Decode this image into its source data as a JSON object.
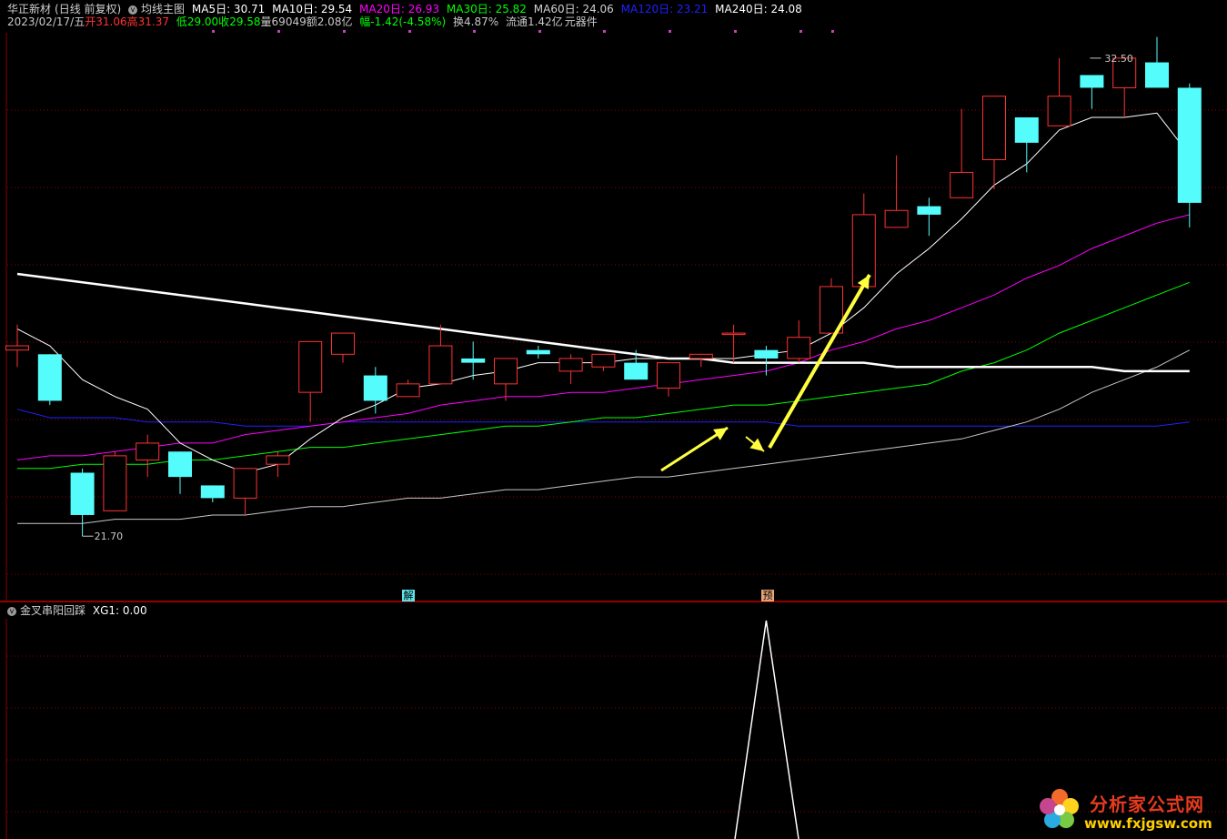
{
  "header": {
    "stock_name": "华正新材",
    "period": "(日线 前复权)",
    "indicator_name": "均线主图",
    "ma5": "MA5日: 30.71",
    "ma10": "MA10日: 29.54",
    "ma20": "MA20日: 26.93",
    "ma30": "MA30日: 25.82",
    "ma60": "MA60日: 24.06",
    "ma120": "MA120日: 23.21",
    "ma240": "MA240日: 24.08",
    "date": "2023/02/17/五",
    "open_label": "开",
    "open_val": "31.06",
    "high_label": "高",
    "high_val": "31.37",
    "low_label": "低",
    "low_val": "29.00",
    "close_label": "收",
    "close_val": "29.58",
    "volume": "量69049",
    "amount": "额2.08亿",
    "change": "幅-1.42(-4.58%)",
    "turnover": "换4.87%",
    "float_cap": "流通1.42亿",
    "sector": "元器件"
  },
  "colors": {
    "up": "#ff3232",
    "down": "#54fcfc",
    "ma5": "#ffffff",
    "ma10": "#e0e000",
    "ma20": "#ff00ff",
    "ma30": "#00ff00",
    "ma60": "#c8c8c8",
    "ma120": "#2020ff",
    "ma240": "#ffffff",
    "arrow": "#ffff40",
    "grid": "#8b0000"
  },
  "chart_data": [
    {
      "type": "candlestick",
      "ylim": [
        20.5,
        33.6
      ],
      "candles": [
        {
          "o": 26.1,
          "h": 26.7,
          "l": 25.7,
          "c": 26.2
        },
        {
          "o": 26.0,
          "h": 26.0,
          "l": 24.8,
          "c": 24.9
        },
        {
          "o": 23.2,
          "h": 23.3,
          "l": 21.7,
          "c": 22.2
        },
        {
          "o": 22.3,
          "h": 23.7,
          "l": 22.3,
          "c": 23.6
        },
        {
          "o": 23.5,
          "h": 24.1,
          "l": 23.1,
          "c": 23.9
        },
        {
          "o": 23.7,
          "h": 23.7,
          "l": 22.7,
          "c": 23.1
        },
        {
          "o": 22.9,
          "h": 22.9,
          "l": 22.5,
          "c": 22.6
        },
        {
          "o": 22.6,
          "h": 23.3,
          "l": 22.2,
          "c": 23.3
        },
        {
          "o": 23.4,
          "h": 23.7,
          "l": 23.1,
          "c": 23.6
        },
        {
          "o": 25.1,
          "h": 25.6,
          "l": 24.4,
          "c": 26.3
        },
        {
          "o": 26.0,
          "h": 26.3,
          "l": 25.8,
          "c": 26.5
        },
        {
          "o": 25.5,
          "h": 25.7,
          "l": 24.6,
          "c": 24.9
        },
        {
          "o": 25.0,
          "h": 25.4,
          "l": 25.2,
          "c": 25.3
        },
        {
          "o": 25.3,
          "h": 26.7,
          "l": 25.3,
          "c": 26.2
        },
        {
          "o": 25.9,
          "h": 26.3,
          "l": 25.4,
          "c": 25.8
        },
        {
          "o": 25.3,
          "h": 25.5,
          "l": 24.9,
          "c": 25.9
        },
        {
          "o": 26.1,
          "h": 26.2,
          "l": 25.9,
          "c": 26.0
        },
        {
          "o": 25.6,
          "h": 26.0,
          "l": 25.3,
          "c": 25.9
        },
        {
          "o": 25.7,
          "h": 25.9,
          "l": 25.6,
          "c": 26.0
        },
        {
          "o": 25.8,
          "h": 26.1,
          "l": 25.4,
          "c": 25.4
        },
        {
          "o": 25.2,
          "h": 25.7,
          "l": 25.0,
          "c": 25.8
        },
        {
          "o": 25.9,
          "h": 26.0,
          "l": 25.7,
          "c": 26.0
        },
        {
          "o": 26.5,
          "h": 26.7,
          "l": 25.8,
          "c": 26.5
        },
        {
          "o": 26.1,
          "h": 26.2,
          "l": 25.5,
          "c": 25.9
        },
        {
          "o": 25.9,
          "h": 26.8,
          "l": 25.8,
          "c": 26.4
        },
        {
          "o": 26.5,
          "h": 27.8,
          "l": 26.5,
          "c": 27.6
        },
        {
          "o": 27.6,
          "h": 29.8,
          "l": 27.6,
          "c": 29.3
        },
        {
          "o": 29.0,
          "h": 30.7,
          "l": 29.0,
          "c": 29.4
        },
        {
          "o": 29.5,
          "h": 29.7,
          "l": 28.8,
          "c": 29.3
        },
        {
          "o": 29.7,
          "h": 31.8,
          "l": 29.7,
          "c": 30.3
        },
        {
          "o": 30.6,
          "h": 32.1,
          "l": 29.9,
          "c": 32.1
        },
        {
          "o": 31.6,
          "h": 31.6,
          "l": 30.3,
          "c": 31.0
        },
        {
          "o": 31.4,
          "h": 33.0,
          "l": 31.4,
          "c": 32.1
        },
        {
          "o": 32.6,
          "h": 32.6,
          "l": 31.8,
          "c": 32.3
        },
        {
          "o": 32.3,
          "h": 32.9,
          "l": 31.6,
          "c": 33.0
        },
        {
          "o": 32.9,
          "h": 33.5,
          "l": 32.5,
          "c": 32.3
        },
        {
          "o": 32.3,
          "h": 32.4,
          "l": 29.0,
          "c": 29.58
        }
      ],
      "ma5": [
        26.6,
        26.2,
        25.4,
        25.0,
        24.7,
        23.9,
        23.5,
        23.2,
        23.4,
        24.0,
        24.5,
        24.8,
        25.2,
        25.3,
        25.5,
        25.6,
        25.8,
        25.8,
        25.8,
        25.9,
        25.9,
        25.9,
        25.9,
        26.0,
        26.1,
        26.5,
        27.1,
        27.9,
        28.5,
        29.2,
        30.0,
        30.5,
        31.3,
        31.6,
        31.6,
        31.7,
        30.71
      ],
      "ma20": [
        23.5,
        23.6,
        23.6,
        23.7,
        23.8,
        23.9,
        23.9,
        24.1,
        24.2,
        24.3,
        24.4,
        24.5,
        24.6,
        24.8,
        24.9,
        25.0,
        25.0,
        25.1,
        25.1,
        25.2,
        25.3,
        25.4,
        25.5,
        25.6,
        25.8,
        26.1,
        26.3,
        26.6,
        26.8,
        27.1,
        27.4,
        27.8,
        28.1,
        28.5,
        28.8,
        29.1,
        29.3
      ],
      "ma30": [
        23.3,
        23.3,
        23.4,
        23.4,
        23.4,
        23.5,
        23.5,
        23.6,
        23.7,
        23.8,
        23.8,
        23.9,
        24.0,
        24.1,
        24.2,
        24.3,
        24.3,
        24.4,
        24.5,
        24.5,
        24.6,
        24.7,
        24.8,
        24.8,
        24.9,
        25.0,
        25.1,
        25.2,
        25.3,
        25.6,
        25.8,
        26.1,
        26.5,
        26.8,
        27.1,
        27.4,
        27.7
      ],
      "ma60": [
        22.0,
        22.0,
        22.0,
        22.1,
        22.1,
        22.1,
        22.2,
        22.2,
        22.3,
        22.4,
        22.4,
        22.5,
        22.6,
        22.6,
        22.7,
        22.8,
        22.8,
        22.9,
        23.0,
        23.1,
        23.1,
        23.2,
        23.3,
        23.4,
        23.5,
        23.6,
        23.7,
        23.8,
        23.9,
        24.0,
        24.2,
        24.4,
        24.7,
        25.1,
        25.4,
        25.7,
        26.1
      ],
      "ma120": [
        24.7,
        24.5,
        24.5,
        24.5,
        24.4,
        24.4,
        24.4,
        24.3,
        24.3,
        24.3,
        24.4,
        24.4,
        24.4,
        24.4,
        24.4,
        24.4,
        24.4,
        24.4,
        24.4,
        24.4,
        24.4,
        24.4,
        24.4,
        24.4,
        24.3,
        24.3,
        24.3,
        24.3,
        24.3,
        24.3,
        24.3,
        24.3,
        24.3,
        24.3,
        24.3,
        24.3,
        24.4
      ],
      "ma240": [
        27.9,
        27.8,
        27.7,
        27.6,
        27.5,
        27.4,
        27.3,
        27.2,
        27.1,
        27.0,
        26.9,
        26.8,
        26.7,
        26.6,
        26.5,
        26.4,
        26.3,
        26.2,
        26.1,
        26.0,
        25.9,
        25.9,
        25.8,
        25.8,
        25.8,
        25.8,
        25.8,
        25.7,
        25.7,
        25.7,
        25.7,
        25.7,
        25.7,
        25.7,
        25.6,
        25.6,
        25.6
      ],
      "annotations": {
        "high_label": "32.50",
        "low_label": "21.70",
        "signal_markers": [
          "解",
          "预"
        ]
      }
    },
    {
      "type": "line",
      "title": "金叉串阳回踩",
      "series_label": "XG1: 0.00",
      "values": [
        0,
        0,
        0,
        0,
        0,
        0,
        0,
        0,
        0,
        0,
        0,
        0,
        0,
        0,
        0,
        0,
        0,
        0,
        0,
        0,
        0,
        0,
        0,
        1,
        0,
        0,
        0,
        0,
        0,
        0,
        0,
        0,
        0,
        0,
        0,
        0,
        0
      ],
      "ylim": [
        0,
        1
      ]
    }
  ],
  "tags": {
    "jie": "解",
    "yu": "预"
  },
  "logo": {
    "name": "分析家公式网",
    "url": "www.fxjgsw.com"
  }
}
